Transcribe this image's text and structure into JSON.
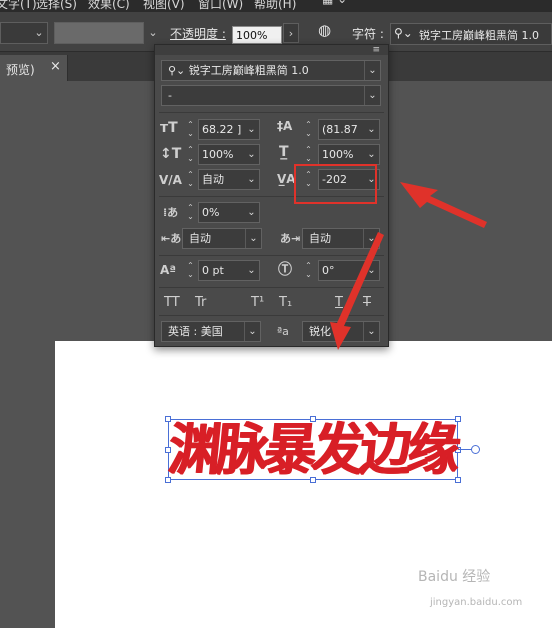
{
  "menu": {
    "items": [
      "文字(T)",
      "选择(S)",
      "效果(C)",
      "视图(V)",
      "窗口(W)",
      "帮助(H)"
    ]
  },
  "control_bar": {
    "opacity_label": "不透明度 :",
    "opacity_value": "100%",
    "character_label": "字符 :",
    "font_value": "锐字工房巅峰粗黑简 1.0"
  },
  "tab": {
    "label": "预览)",
    "close": "×"
  },
  "panel": {
    "font_family": "锐字工房巅峰粗黑简 1.0",
    "font_style": "-",
    "font_size": "68.22 ]",
    "leading": "(81.87",
    "vertical_scale": "100%",
    "horizontal_scale": "100%",
    "kerning": "自动",
    "tracking": "-202",
    "tsume": "0%",
    "aki_left": "自动",
    "aki_right": "自动",
    "baseline_shift": "0 pt",
    "rotation": "0°",
    "style_buttons": [
      "TT",
      "Tr",
      "T¹",
      "T₁",
      "T",
      "T"
    ],
    "language": "英语 : 美国",
    "antialias": "锐化",
    "aa_icon": "ªa"
  },
  "artboard": {
    "text": "渊脉暴发边缘"
  },
  "watermark": {
    "line1": "Baidu 经验",
    "line2": "jingyan.baidu.com"
  },
  "colors": {
    "accent_red": "#e0322a",
    "text_red": "#d81f26",
    "selection_blue": "#4a6fd6"
  }
}
